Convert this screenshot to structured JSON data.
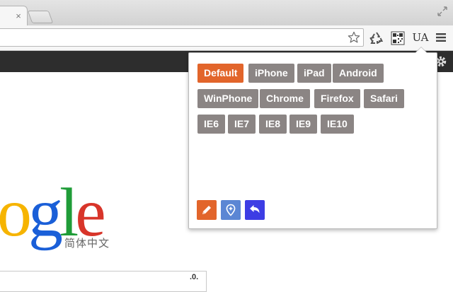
{
  "browser": {
    "tab_close_glyph": "×"
  },
  "toolbar": {
    "ext_ua_label": "UA"
  },
  "page": {
    "logo_letters": [
      "o",
      "g",
      "l",
      "e"
    ],
    "logo_subtitle": "简体中文",
    "search_tool_text": ".0."
  },
  "popup": {
    "user_agents": [
      "Default",
      "iPhone",
      "iPad",
      "Android",
      "WinPhone",
      "Chrome",
      "Firefox",
      "Safari",
      "IE6",
      "IE7",
      "IE8",
      "IE9",
      "IE10"
    ],
    "selected": "Default",
    "tools": [
      "pencil-icon",
      "map-pin-icon",
      "undo-icon"
    ],
    "colors": {
      "selected_button": "#e2652b",
      "button": "#8b8584",
      "edit_tool": "#e2652b",
      "location_tool": "#5b86d4",
      "reset_tool": "#3d3de4"
    }
  }
}
